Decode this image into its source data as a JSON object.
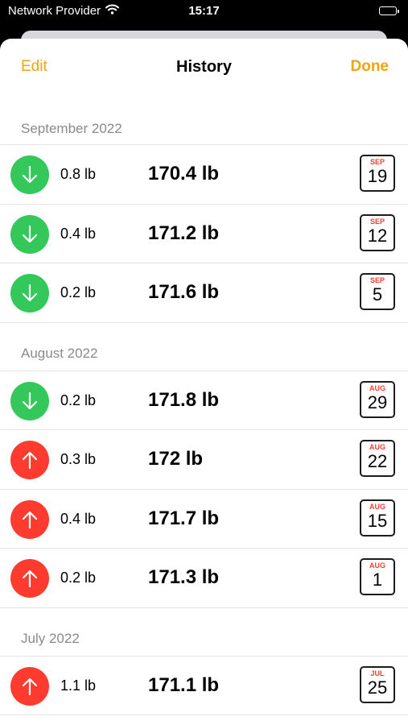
{
  "status_bar": {
    "carrier": "Network Provider",
    "time": "15:17"
  },
  "nav": {
    "edit_label": "Edit",
    "title": "History",
    "done_label": "Done"
  },
  "colors": {
    "accent": "#f5a30a",
    "decrease": "#34c759",
    "increase": "#ff3b30"
  },
  "sections": [
    {
      "title": "September 2022",
      "rows": [
        {
          "direction": "down",
          "delta": "0.8 lb",
          "weight": "170.4 lb",
          "month": "SEP",
          "day": "19"
        },
        {
          "direction": "down",
          "delta": "0.4 lb",
          "weight": "171.2 lb",
          "month": "SEP",
          "day": "12"
        },
        {
          "direction": "down",
          "delta": "0.2 lb",
          "weight": "171.6 lb",
          "month": "SEP",
          "day": "5"
        }
      ]
    },
    {
      "title": "August 2022",
      "rows": [
        {
          "direction": "down",
          "delta": "0.2 lb",
          "weight": "171.8 lb",
          "month": "AUG",
          "day": "29"
        },
        {
          "direction": "up",
          "delta": "0.3 lb",
          "weight": "172 lb",
          "month": "AUG",
          "day": "22"
        },
        {
          "direction": "up",
          "delta": "0.4 lb",
          "weight": "171.7 lb",
          "month": "AUG",
          "day": "15"
        },
        {
          "direction": "up",
          "delta": "0.2 lb",
          "weight": "171.3 lb",
          "month": "AUG",
          "day": "1"
        }
      ]
    },
    {
      "title": "July 2022",
      "rows": [
        {
          "direction": "up",
          "delta": "1.1 lb",
          "weight": "171.1 lb",
          "month": "JUL",
          "day": "25"
        }
      ]
    }
  ]
}
